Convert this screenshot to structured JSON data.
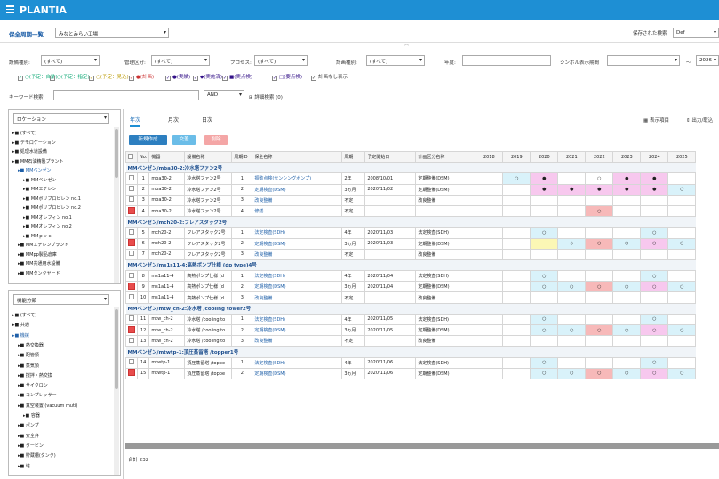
{
  "app": {
    "title": "PLANTIA"
  },
  "page": {
    "title": "保全周期一覧",
    "site_select": "みなとみらい工場",
    "saved_search_label": "保存された検索",
    "saved_search_value": "Def"
  },
  "filters": {
    "facility_type_label": "設備種別:",
    "facility_type_value": "(すべて)",
    "mgmt_section_label": "管理区分:",
    "mgmt_section_value": "(すべて)",
    "process_label": "プロセス:",
    "process_value": "(すべて)",
    "plan_type_label": "計画種別:",
    "plan_type_value": "(すべて)",
    "year_label": "年度:",
    "symbol_period_label": "シンボル表示期間",
    "range_sep": "～",
    "range_end": "2026"
  },
  "legend_checks": [
    {
      "label": "○(予定：自動)"
    },
    {
      "label": "○(予定：指定)"
    },
    {
      "label": "○(予定：見込)"
    },
    {
      "label": "●(計画)"
    },
    {
      "label": "●(実績)"
    },
    {
      "label": "◆(実施済)"
    },
    {
      "label": "■(実点検)"
    },
    {
      "label": "□(要点検)"
    },
    {
      "label": "計画なし表示"
    }
  ],
  "keyword": {
    "label": "キーワード検索:",
    "op": "AND",
    "advanced": "詳細検索 (0)"
  },
  "location_panel": {
    "select": "ロケーション",
    "items": [
      "(すべて)",
      "デモロケーション",
      "処理水道設備",
      "MM石油精製プラント",
      "MMベンゼン",
      "MMベンゼン",
      "MMエチレン",
      "MMポリプロピレン no.1",
      "MMポリプロピレン no.2",
      "MMオレフィン no.1",
      "MMオレフィン no.2",
      "MMｐｖｃ",
      "MMエチレンプラント",
      "MMpp製品倉庫",
      "MM共通用水設備",
      "MMタンクヤード"
    ]
  },
  "type_panel": {
    "select": "機能分類",
    "items": [
      "(すべて)",
      "共通",
      "機械",
      "熱交換器",
      "配管類",
      "蒸気類",
      "撹拌・熱交換",
      "サイクロン",
      "コンプレッサー",
      "真空装置 (vacuum muti)",
      "容器",
      "ポンプ",
      "安全弁",
      "タービン",
      "貯蔵槽(タンク)",
      "塔"
    ]
  },
  "tabs": [
    "年次",
    "月次",
    "日次"
  ],
  "toolbar": {
    "new_label": "新規作成",
    "copy_label": "交差",
    "delete_label": "削除",
    "display_label": "表示項目",
    "export_label": "出力/取込"
  },
  "table": {
    "headers": [
      "No.",
      "機器",
      "設備名称",
      "周期ID",
      "保全名称",
      "周期",
      "予定開始日",
      "計画区分名称",
      "2018",
      "2019",
      "2020",
      "2021",
      "2022",
      "2023",
      "2024",
      "2025"
    ],
    "groups": [
      {
        "title": "MMベンゼン/mba30-2:冷水塔ファン2号",
        "rows": [
          {
            "no": "1",
            "equip": "mba30-2",
            "name": "冷水塔ファン2号",
            "id": "1",
            "maint": "振動点検(センシングポンプ)",
            "cycle": "2年",
            "start": "2008/10/01",
            "plan": "定期整備(DSM)",
            "red": false
          },
          {
            "no": "2",
            "equip": "mba30-2",
            "name": "冷水塔ファン2号",
            "id": "2",
            "maint": "定期検査(DSM)",
            "cycle": "3ヵ月",
            "start": "2020/11/02",
            "plan": "定期整備(DSM)",
            "red": false
          },
          {
            "no": "3",
            "equip": "mba30-2",
            "name": "冷水塔ファン2号",
            "id": "3",
            "maint": "改良整備",
            "cycle": "不定",
            "start": "",
            "plan": "改良整備",
            "red": false
          },
          {
            "no": "4",
            "equip": "mba30-2",
            "name": "冷水塔ファン2号",
            "id": "4",
            "maint": "修繕",
            "cycle": "不定",
            "start": "",
            "plan": "",
            "red": true
          }
        ]
      },
      {
        "title": "MMベンゼン/mch20-2:フレアスタック2号",
        "rows": [
          {
            "no": "5",
            "equip": "mch20-2",
            "name": "フレアスタック2号",
            "id": "1",
            "maint": "法定検査(SDH)",
            "cycle": "4年",
            "start": "2020/11/03",
            "plan": "法定検査(SDH)",
            "red": false
          },
          {
            "no": "6",
            "equip": "mch20-2",
            "name": "フレアスタック2号",
            "id": "2",
            "maint": "定期検査(DSM)",
            "cycle": "3ヵ月",
            "start": "2020/11/03",
            "plan": "定期整備(DSM)",
            "red": true
          },
          {
            "no": "7",
            "equip": "mch20-2",
            "name": "フレアスタック2号",
            "id": "3",
            "maint": "改良整備",
            "cycle": "不定",
            "start": "",
            "plan": "改良整備",
            "red": false
          }
        ]
      },
      {
        "title": "MMベンゼン/ms1s11-4:高熱ポンプ仕様 (dp type)4号",
        "rows": [
          {
            "no": "8",
            "equip": "ms1a11-4",
            "name": "高熱ポンプ仕様 (d",
            "id": "1",
            "maint": "法定検査(SDH)",
            "cycle": "4年",
            "start": "2020/11/04",
            "plan": "法定検査(SDH)",
            "red": false
          },
          {
            "no": "9",
            "equip": "ms1a11-4",
            "name": "高熱ポンプ仕様 (d",
            "id": "2",
            "maint": "定期検査(DSM)",
            "cycle": "3ヵ月",
            "start": "2020/11/04",
            "plan": "定期整備(DSM)",
            "red": true
          },
          {
            "no": "10",
            "equip": "ms1a11-4",
            "name": "高熱ポンプ仕様 (d",
            "id": "3",
            "maint": "改良整備",
            "cycle": "不定",
            "start": "",
            "plan": "改良整備",
            "red": false
          }
        ]
      },
      {
        "title": "MMベンゼン/mtw_ch-2:冷水塔 /cooling tower2号",
        "rows": [
          {
            "no": "11",
            "equip": "mtw_ch-2",
            "name": "冷水塔 /cooling to",
            "id": "1",
            "maint": "法定検査(SDH)",
            "cycle": "4年",
            "start": "2020/11/05",
            "plan": "法定検査(SDH)",
            "red": false
          },
          {
            "no": "12",
            "equip": "mtw_ch-2",
            "name": "冷水塔 /cooling to",
            "id": "2",
            "maint": "定期検査(DSM)",
            "cycle": "3ヵ月",
            "start": "2020/11/05",
            "plan": "定期整備(DSM)",
            "red": true
          },
          {
            "no": "13",
            "equip": "mtw_ch-2",
            "name": "冷水塔 /cooling to",
            "id": "3",
            "maint": "改良整備",
            "cycle": "不定",
            "start": "",
            "plan": "改良整備",
            "red": false
          }
        ]
      },
      {
        "title": "MMベンゼン/mtwtp-1:頂圧蒸留塔 /topper1号",
        "rows": [
          {
            "no": "14",
            "equip": "mtwtp-1",
            "name": "頂圧蒸留塔 /toppe",
            "id": "1",
            "maint": "法定検査(SDH)",
            "cycle": "4年",
            "start": "2020/11/06",
            "plan": "法定検査(SDH)",
            "red": false
          },
          {
            "no": "15",
            "equip": "mtwtp-1",
            "name": "頂圧蒸留塔 /toppe",
            "id": "2",
            "maint": "定期検査(DSM)",
            "cycle": "3ヵ月",
            "start": "2020/11/06",
            "plan": "定期整備(DSM)",
            "red": true
          }
        ]
      }
    ],
    "year_cells": {
      "1": [
        "",
        "○",
        "●",
        "",
        "○",
        "●",
        "●",
        ""
      ],
      "2": [
        "",
        "",
        "●",
        "●",
        "●",
        "●",
        "●",
        "○"
      ],
      "4": [
        "",
        "",
        "",
        "",
        "○",
        "",
        "",
        ""
      ],
      "5": [
        "",
        "",
        "○",
        "",
        "",
        "",
        "○",
        ""
      ],
      "6": [
        "",
        "",
        "−",
        "◇",
        "○",
        "○",
        "○",
        "○"
      ],
      "8": [
        "",
        "",
        "○",
        "",
        "",
        "",
        "○",
        ""
      ],
      "9": [
        "",
        "",
        "○",
        "○",
        "○",
        "○",
        "○",
        "○"
      ],
      "11": [
        "",
        "",
        "○",
        "",
        "",
        "",
        "○",
        ""
      ],
      "12": [
        "",
        "",
        "○",
        "○",
        "○",
        "○",
        "○",
        "○"
      ],
      "14": [
        "",
        "",
        "○",
        "",
        "",
        "",
        "○",
        ""
      ],
      "15": [
        "",
        "",
        "○",
        "○",
        "○",
        "○",
        "○",
        "○"
      ]
    },
    "year_colors": {
      "1": [
        "",
        "cyan",
        "pink",
        "",
        "",
        "pink",
        "pink",
        ""
      ],
      "2": [
        "",
        "",
        "pink",
        "pink",
        "pink",
        "pink",
        "pink",
        "cyan"
      ],
      "4": [
        "",
        "",
        "",
        "",
        "red",
        "",
        "",
        ""
      ],
      "5": [
        "",
        "",
        "cyan",
        "",
        "",
        "",
        "cyan",
        ""
      ],
      "6": [
        "",
        "",
        "yellow",
        "cyan",
        "red",
        "cyan",
        "pink",
        "cyan"
      ],
      "8": [
        "",
        "",
        "cyan",
        "",
        "",
        "",
        "cyan",
        ""
      ],
      "9": [
        "",
        "",
        "cyan",
        "cyan",
        "red",
        "cyan",
        "pink",
        "cyan"
      ],
      "11": [
        "",
        "",
        "cyan",
        "",
        "",
        "",
        "cyan",
        ""
      ],
      "12": [
        "",
        "",
        "cyan",
        "cyan",
        "red",
        "cyan",
        "pink",
        "cyan"
      ],
      "14": [
        "",
        "",
        "cyan",
        "",
        "",
        "",
        "cyan",
        ""
      ],
      "15": [
        "",
        "",
        "cyan",
        "cyan",
        "red",
        "cyan",
        "pink",
        "cyan"
      ]
    }
  },
  "footer": {
    "total": "合計 232"
  }
}
